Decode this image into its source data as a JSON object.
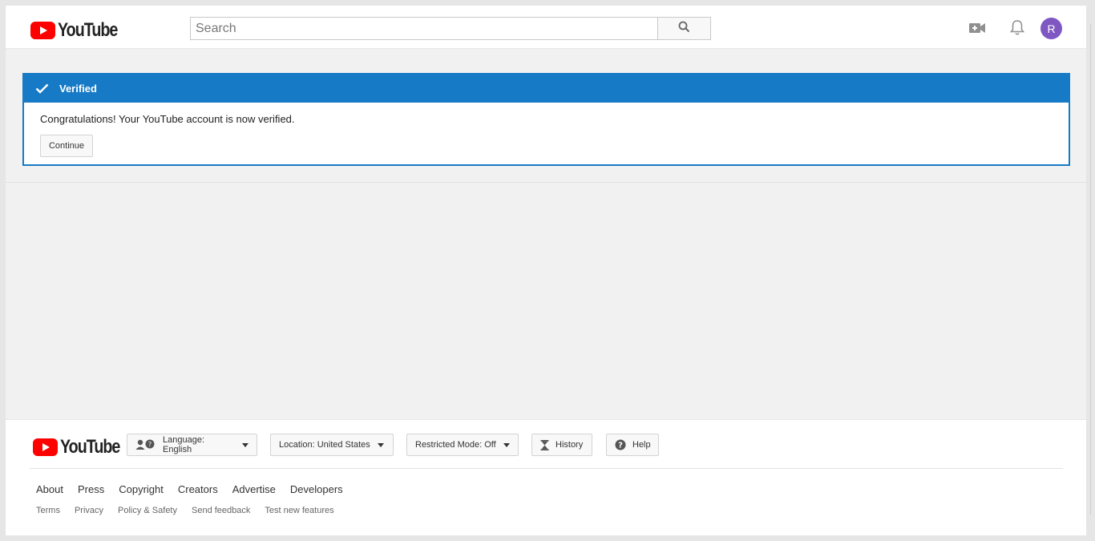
{
  "header": {
    "logo_text": "YouTube",
    "search_placeholder": "Search",
    "avatar_letter": "R"
  },
  "notice": {
    "title": "Verified",
    "message": "Congratulations! Your YouTube account is now verified.",
    "continue_label": "Continue"
  },
  "footer": {
    "logo_text": "YouTube",
    "language_label": "Language: English",
    "location_label": "Location: United States",
    "restricted_label": "Restricted Mode: Off",
    "history_label": "History",
    "help_label": "Help",
    "primary_links": [
      "About",
      "Press",
      "Copyright",
      "Creators",
      "Advertise",
      "Developers"
    ],
    "secondary_links": [
      "Terms",
      "Privacy",
      "Policy & Safety",
      "Send feedback",
      "Test new features"
    ]
  },
  "colors": {
    "brand_red": "#ff0000",
    "accent_blue": "#167ac6",
    "avatar_purple": "#7e57c2"
  },
  "icons": [
    "search-icon",
    "video-camera-icon",
    "bell-icon",
    "check-icon",
    "language-icon",
    "hourglass-icon",
    "help-icon"
  ]
}
